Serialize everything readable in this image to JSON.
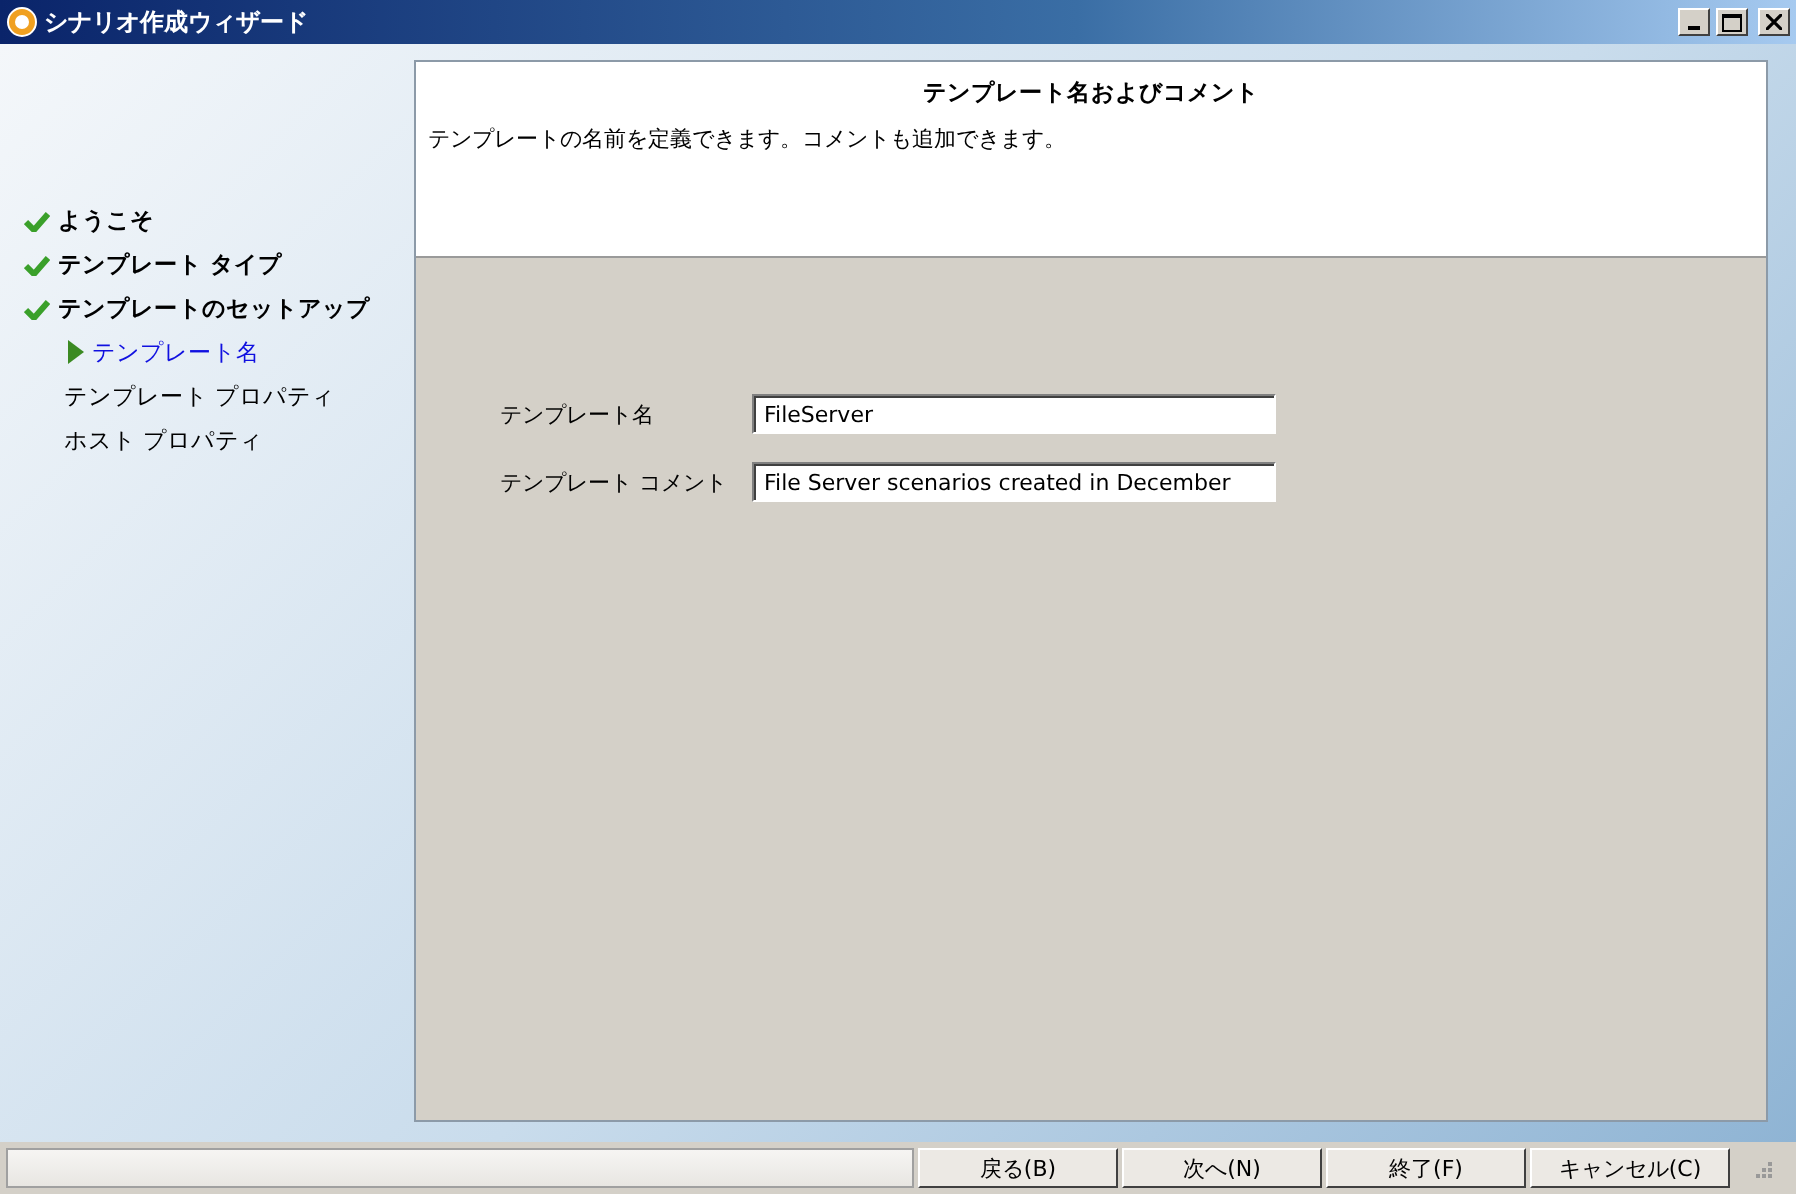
{
  "window": {
    "title": "シナリオ作成ウィザード"
  },
  "steps": [
    {
      "label": "ようこそ",
      "kind": "done"
    },
    {
      "label": "テンプレート タイプ",
      "kind": "done"
    },
    {
      "label": "テンプレートのセットアップ",
      "kind": "done"
    },
    {
      "label": "テンプレート名",
      "kind": "current"
    },
    {
      "label": "テンプレート プロパティ",
      "kind": "pending"
    },
    {
      "label": "ホスト プロパティ",
      "kind": "pending"
    }
  ],
  "header": {
    "title": "テンプレート名およびコメント",
    "description": "テンプレートの名前を定義できます。コメントも追加できます。"
  },
  "fields": [
    {
      "label": "テンプレート名",
      "value": "FileServer"
    },
    {
      "label": "テンプレート コメント",
      "value": "File Server scenarios created in December"
    }
  ],
  "buttons": [
    "戻る(B)",
    "次へ(N)",
    "終了(F)",
    "キャンセル(C)"
  ]
}
